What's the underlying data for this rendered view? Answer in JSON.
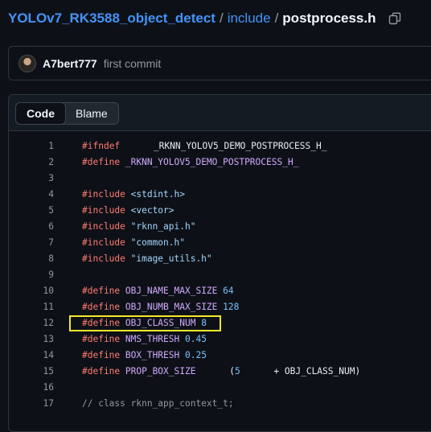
{
  "breadcrumb": {
    "repo": "YOLOv7_RK3588_object_detect",
    "separator": "/",
    "folder": "include",
    "file": "postprocess.h",
    "copy_icon": "copy-icon"
  },
  "commit": {
    "author": "A7bert777",
    "message": "first commit"
  },
  "tabs": {
    "code": "Code",
    "blame": "Blame",
    "active": "Code"
  },
  "code_lines": [
    {
      "n": "1",
      "tokens": [
        {
          "t": "#",
          "c": "kw"
        },
        {
          "t": "ifndef",
          "c": "kw"
        },
        {
          "t": " _RKNN_YOLOV5_DEMO_POSTPROCESS_H_",
          "c": "src"
        }
      ]
    },
    {
      "n": "2",
      "tokens": [
        {
          "t": "#define",
          "c": "kw"
        },
        {
          "t": " _RKNN_YOLOV5_DEMO_POSTPROCESS_H_",
          "c": "mac"
        }
      ]
    },
    {
      "n": "3",
      "tokens": []
    },
    {
      "n": "4",
      "tokens": [
        {
          "t": "#include",
          "c": "kw"
        },
        {
          "t": " <stdint.h>",
          "c": "str"
        }
      ]
    },
    {
      "n": "5",
      "tokens": [
        {
          "t": "#include",
          "c": "kw"
        },
        {
          "t": " <vector>",
          "c": "str"
        }
      ]
    },
    {
      "n": "6",
      "tokens": [
        {
          "t": "#include",
          "c": "kw"
        },
        {
          "t": " \"rknn_api.h\"",
          "c": "str"
        }
      ]
    },
    {
      "n": "7",
      "tokens": [
        {
          "t": "#include",
          "c": "kw"
        },
        {
          "t": " \"common.h\"",
          "c": "str"
        }
      ]
    },
    {
      "n": "8",
      "tokens": [
        {
          "t": "#include",
          "c": "kw"
        },
        {
          "t": " \"image_utils.h\"",
          "c": "str"
        }
      ]
    },
    {
      "n": "9",
      "tokens": []
    },
    {
      "n": "10",
      "tokens": [
        {
          "t": "#define",
          "c": "kw"
        },
        {
          "t": " OBJ_NAME_MAX_SIZE",
          "c": "mac"
        },
        {
          "t": " 64",
          "c": "num"
        }
      ]
    },
    {
      "n": "11",
      "tokens": [
        {
          "t": "#define",
          "c": "kw"
        },
        {
          "t": " OBJ_NUMB_MAX_SIZE",
          "c": "mac"
        },
        {
          "t": " 128",
          "c": "num"
        }
      ]
    },
    {
      "n": "12",
      "tokens": [
        {
          "t": "#define",
          "c": "kw"
        },
        {
          "t": " OBJ_CLASS_NUM",
          "c": "mac"
        },
        {
          "t": " 8",
          "c": "num"
        }
      ]
    },
    {
      "n": "13",
      "tokens": [
        {
          "t": "#define",
          "c": "kw"
        },
        {
          "t": " NMS_THRESH",
          "c": "mac"
        },
        {
          "t": " 0.45",
          "c": "num"
        }
      ]
    },
    {
      "n": "14",
      "tokens": [
        {
          "t": "#define",
          "c": "kw"
        },
        {
          "t": " BOX_THRESH",
          "c": "mac"
        },
        {
          "t": " 0.25",
          "c": "num"
        }
      ]
    },
    {
      "n": "15",
      "tokens": [
        {
          "t": "#define",
          "c": "kw"
        },
        {
          "t": " PROP_BOX_SIZE",
          "c": "mac"
        },
        {
          "t": " (",
          "c": "src"
        },
        {
          "t": "5",
          "c": "num"
        },
        {
          "t": " + OBJ_CLASS_NUM)",
          "c": "src"
        }
      ]
    },
    {
      "n": "16",
      "tokens": []
    },
    {
      "n": "17",
      "tokens": [
        {
          "t": "// class rknn_app_context_t;",
          "c": "cm"
        }
      ]
    }
  ],
  "highlighted_line": "12",
  "colors": {
    "link": "#4493f8",
    "background": "#0d1117",
    "highlight_border": "#f5e62b"
  }
}
